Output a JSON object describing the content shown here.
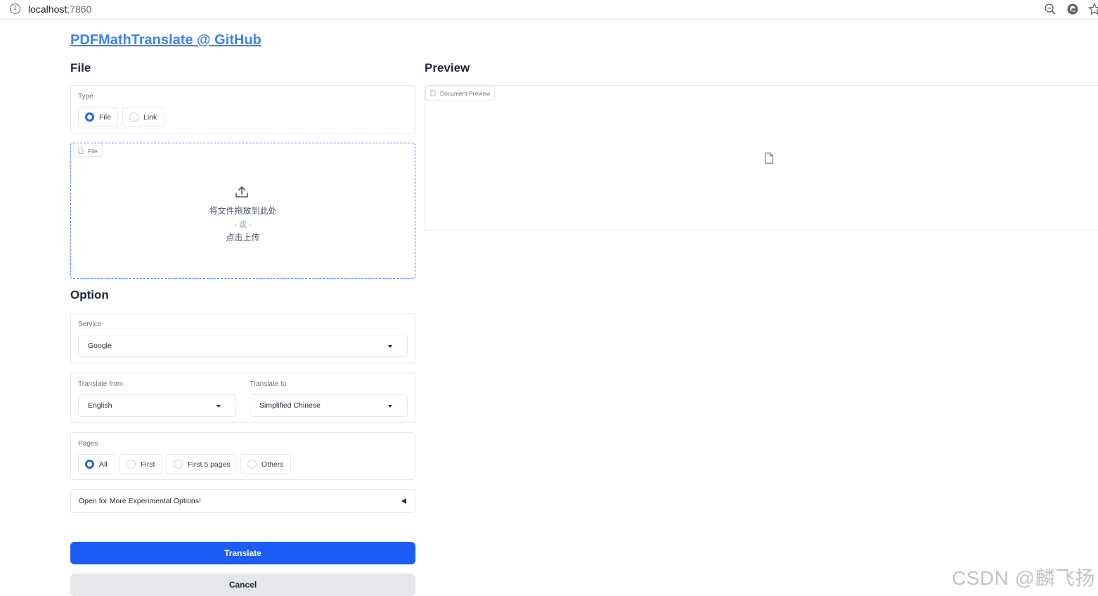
{
  "browser": {
    "url_host": "localhost",
    "url_port": ":7860"
  },
  "header": {
    "title_link": "PDFMathTranslate @ GitHub"
  },
  "file_section": {
    "heading": "File",
    "type_label": "Type",
    "type_options": [
      "File",
      "Link"
    ],
    "type_selected": "File",
    "file_tag": "File",
    "drop_text": "将文件拖放到此处",
    "drop_or": "- 或 -",
    "drop_click": "点击上传"
  },
  "option_section": {
    "heading": "Option",
    "service_label": "Service",
    "service_value": "Google",
    "from_label": "Translate from",
    "from_value": "English",
    "to_label": "Translate to",
    "to_value": "Simplified Chinese",
    "pages_label": "Pages",
    "pages_options": [
      "All",
      "First",
      "First 5 pages",
      "Others"
    ],
    "pages_selected": "All",
    "accordion_label": "Open for More Experimental Options!"
  },
  "buttons": {
    "translate": "Translate",
    "cancel": "Cancel"
  },
  "preview_section": {
    "heading": "Preview",
    "tag": "Document Preview"
  },
  "watermark": "CSDN @麟飞扬",
  "colors": {
    "accent": "#1d5cf5",
    "link": "#3b82f6",
    "border": "#e5e7eb"
  }
}
